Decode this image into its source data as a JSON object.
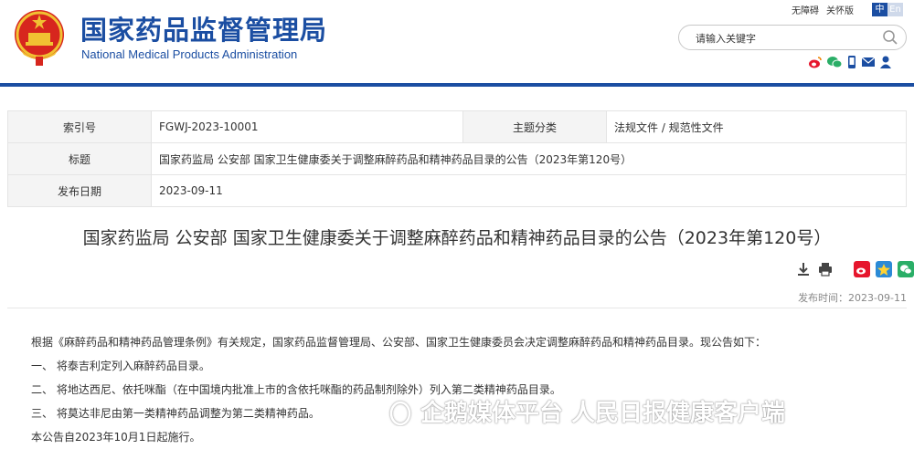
{
  "header": {
    "title": "国家药品监督管理局",
    "subtitle": "National Medical Products Administration",
    "links": [
      "无障碍",
      "关怀版"
    ],
    "lang": [
      "中",
      "En"
    ],
    "search_placeholder": "请输入关键字"
  },
  "info": {
    "rows": [
      {
        "label1": "索引号",
        "value1": "FGWJ-2023-10001",
        "label2": "主题分类",
        "value2": "法规文件 / 规范性文件"
      },
      {
        "label1": "标题",
        "value1": "国家药监局 公安部 国家卫生健康委关于调整麻醉药品和精神药品目录的公告（2023年第120号）"
      },
      {
        "label1": "发布日期",
        "value1": "2023-09-11"
      }
    ]
  },
  "article": {
    "title": "国家药监局 公安部 国家卫生健康委关于调整麻醉药品和精神药品目录的公告（2023年第120号）",
    "pubdate": "发布时间：2023-09-11",
    "paragraphs": [
      "根据《麻醉药品和精神药品管理条例》有关规定，国家药品监督管理局、公安部、国家卫生健康委员会决定调整麻醉药品和精神药品目录。现公告如下：",
      "一、 将泰吉利定列入麻醉药品目录。",
      "二、 将地达西尼、依托咪酯（在中国境内批准上市的含依托咪酯的药品制剂除外）列入第二类精神药品目录。",
      "三、 将莫达非尼由第一类精神药品调整为第二类精神药品。",
      "本公告自2023年10月1日起施行。"
    ]
  },
  "watermark": "企鹅媒体平台 人民日报健康客户端",
  "colors": {
    "brand": "#1b4ea2",
    "emblem_red": "#d7261e",
    "emblem_gold": "#f1c232"
  }
}
